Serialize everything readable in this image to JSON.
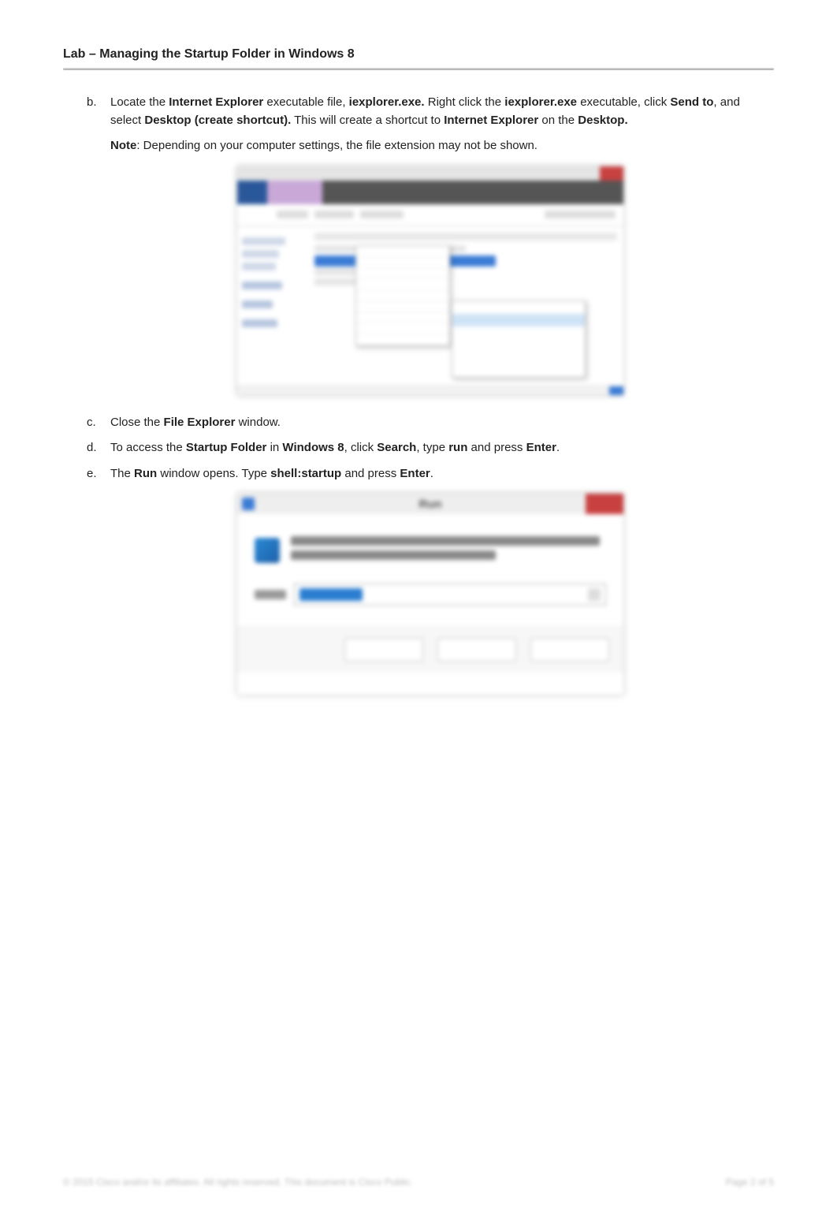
{
  "header": {
    "title": "Lab – Managing the Startup Folder in Windows 8"
  },
  "items": {
    "b": {
      "marker": "b.",
      "t1": "Locate the ",
      "t2": "Internet Explorer",
      "t3": " executable file, ",
      "t4": "iexplorer.exe.",
      "t5": " Right click the ",
      "t6": "iexplorer.exe",
      "t7": " executable, click ",
      "t8": "Send to",
      "t9": ", and select ",
      "t10": "Desktop (create shortcut).",
      "t11": " This will create a shortcut to ",
      "t12": "Internet Explorer",
      "t13": " on the ",
      "t14": "Desktop."
    },
    "note": {
      "label": "Note",
      "text": ": Depending on your computer settings, the file extension may not be shown."
    },
    "c": {
      "marker": "c.",
      "t1": "Close the ",
      "t2": "File Explorer",
      "t3": " window."
    },
    "d": {
      "marker": "d.",
      "t1": "To access the ",
      "t2": "Startup Folder",
      "t3": " in ",
      "t4": "Windows 8",
      "t5": ", click ",
      "t6": "Search",
      "t7": ", type ",
      "t8": "run",
      "t9": " and press ",
      "t10": "Enter",
      "t11": "."
    },
    "e": {
      "marker": "e.",
      "t1": "The ",
      "t2": "Run",
      "t3": " window opens. Type ",
      "t4": "shell:startup",
      "t5": " and press ",
      "t6": "Enter",
      "t7": "."
    }
  },
  "fig2": {
    "title": "Run",
    "open_value": "shell:startup"
  },
  "footer": {
    "left": "© 2015 Cisco and/or its affiliates. All rights reserved. This document is Cisco Public.",
    "right": "Page 2 of 5"
  }
}
